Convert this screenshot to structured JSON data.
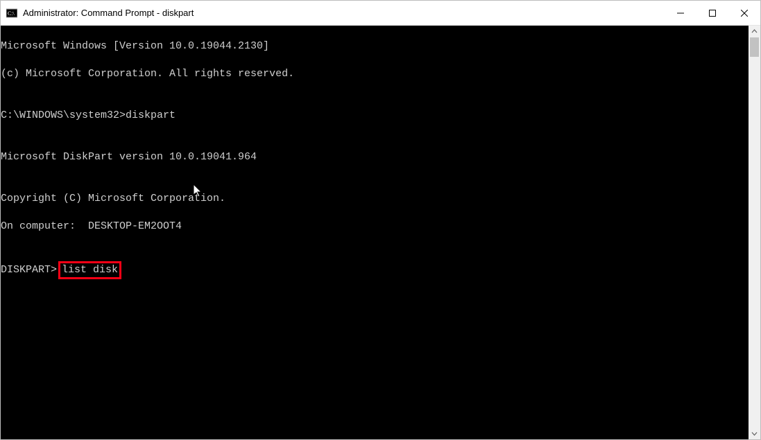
{
  "window": {
    "title": "Administrator: Command Prompt - diskpart"
  },
  "terminal": {
    "line1": "Microsoft Windows [Version 10.0.19044.2130]",
    "line2": "(c) Microsoft Corporation. All rights reserved.",
    "blank1": "",
    "prompt1_path": "C:\\WINDOWS\\system32>",
    "prompt1_cmd": "diskpart",
    "blank2": "",
    "line3": "Microsoft DiskPart version 10.0.19041.964",
    "blank3": "",
    "line4": "Copyright (C) Microsoft Corporation.",
    "line5": "On computer:  DESKTOP-EM2OOT4",
    "blank4": "",
    "prompt2_label": "DISKPART>",
    "prompt2_cmd": "list disk"
  },
  "icons": {
    "app": "cmd-icon",
    "minimize": "minimize-icon",
    "maximize": "maximize-icon",
    "close": "close-icon",
    "scroll_up": "chevron-up-icon",
    "scroll_down": "chevron-down-icon"
  }
}
